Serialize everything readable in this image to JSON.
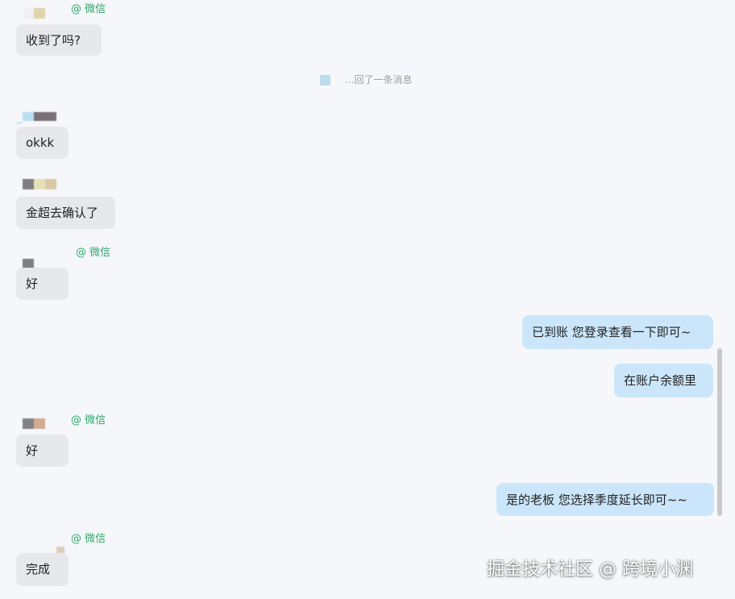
{
  "colors": {
    "background": "#f5f7fa",
    "incoming_bubble": "#e6e8eb",
    "outgoing_bubble": "#cbe6fa",
    "wechat_tag": "#2fa86a",
    "system_text": "#9aa0a6"
  },
  "messages": [
    {
      "tag": "@ 微信",
      "text": "收到了吗?"
    },
    {
      "system": "...回了一条消息"
    },
    {
      "text": "okkk"
    },
    {
      "text": "金超去确认了"
    },
    {
      "tag": "@ 微信",
      "text": "好"
    },
    {
      "text": "已到账 您登录查看一下即可~"
    },
    {
      "text": "在账户余额里"
    },
    {
      "tag": "@ 微信",
      "text": "好"
    },
    {
      "text": "是的老板  您选择季度延长即可~~"
    },
    {
      "tag": "@ 微信",
      "text": "完成"
    }
  ],
  "watermark": "掘金技术社区 @ 跨境小渊"
}
